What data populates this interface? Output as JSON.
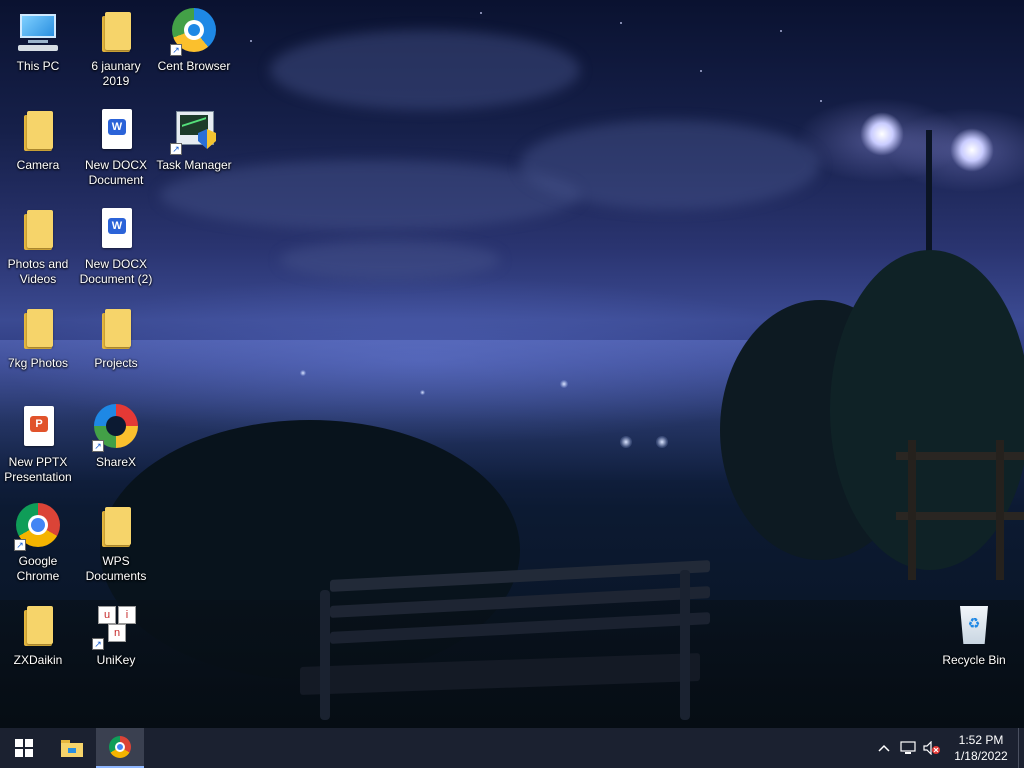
{
  "desktop": {
    "icons": {
      "this_pc": "This PC",
      "folder_6jan": "6 jaunary 2019",
      "cent_browser": "Cent Browser",
      "camera": "Camera",
      "new_docx": "New DOCX Document",
      "task_manager": "Task Manager",
      "photos_videos": "Photos and Videos",
      "new_docx_2": "New DOCX Document (2)",
      "7kg_photos": "7kg Photos",
      "projects": "Projects",
      "new_pptx": "New PPTX Presentation",
      "sharex": "ShareX",
      "google_chrome": "Google Chrome",
      "wps_documents": "WPS Documents",
      "zxdaikin": "ZXDaikin",
      "unikey": "UniKey",
      "recycle_bin": "Recycle Bin"
    }
  },
  "taskbar": {
    "start_icon": "windows-logo-icon",
    "pinned": [
      "file-explorer-icon",
      "google-chrome-icon"
    ],
    "tray": {
      "icons": [
        "chevron-up-icon",
        "network-icon",
        "volume-muted-icon"
      ],
      "time": "1:52 PM",
      "date": "1/18/2022"
    }
  },
  "colors": {
    "taskbar_bg": "#1b2130",
    "folder": "#f6d46a",
    "word_blue": "#2b63d8",
    "ppt_orange": "#e1532b"
  }
}
